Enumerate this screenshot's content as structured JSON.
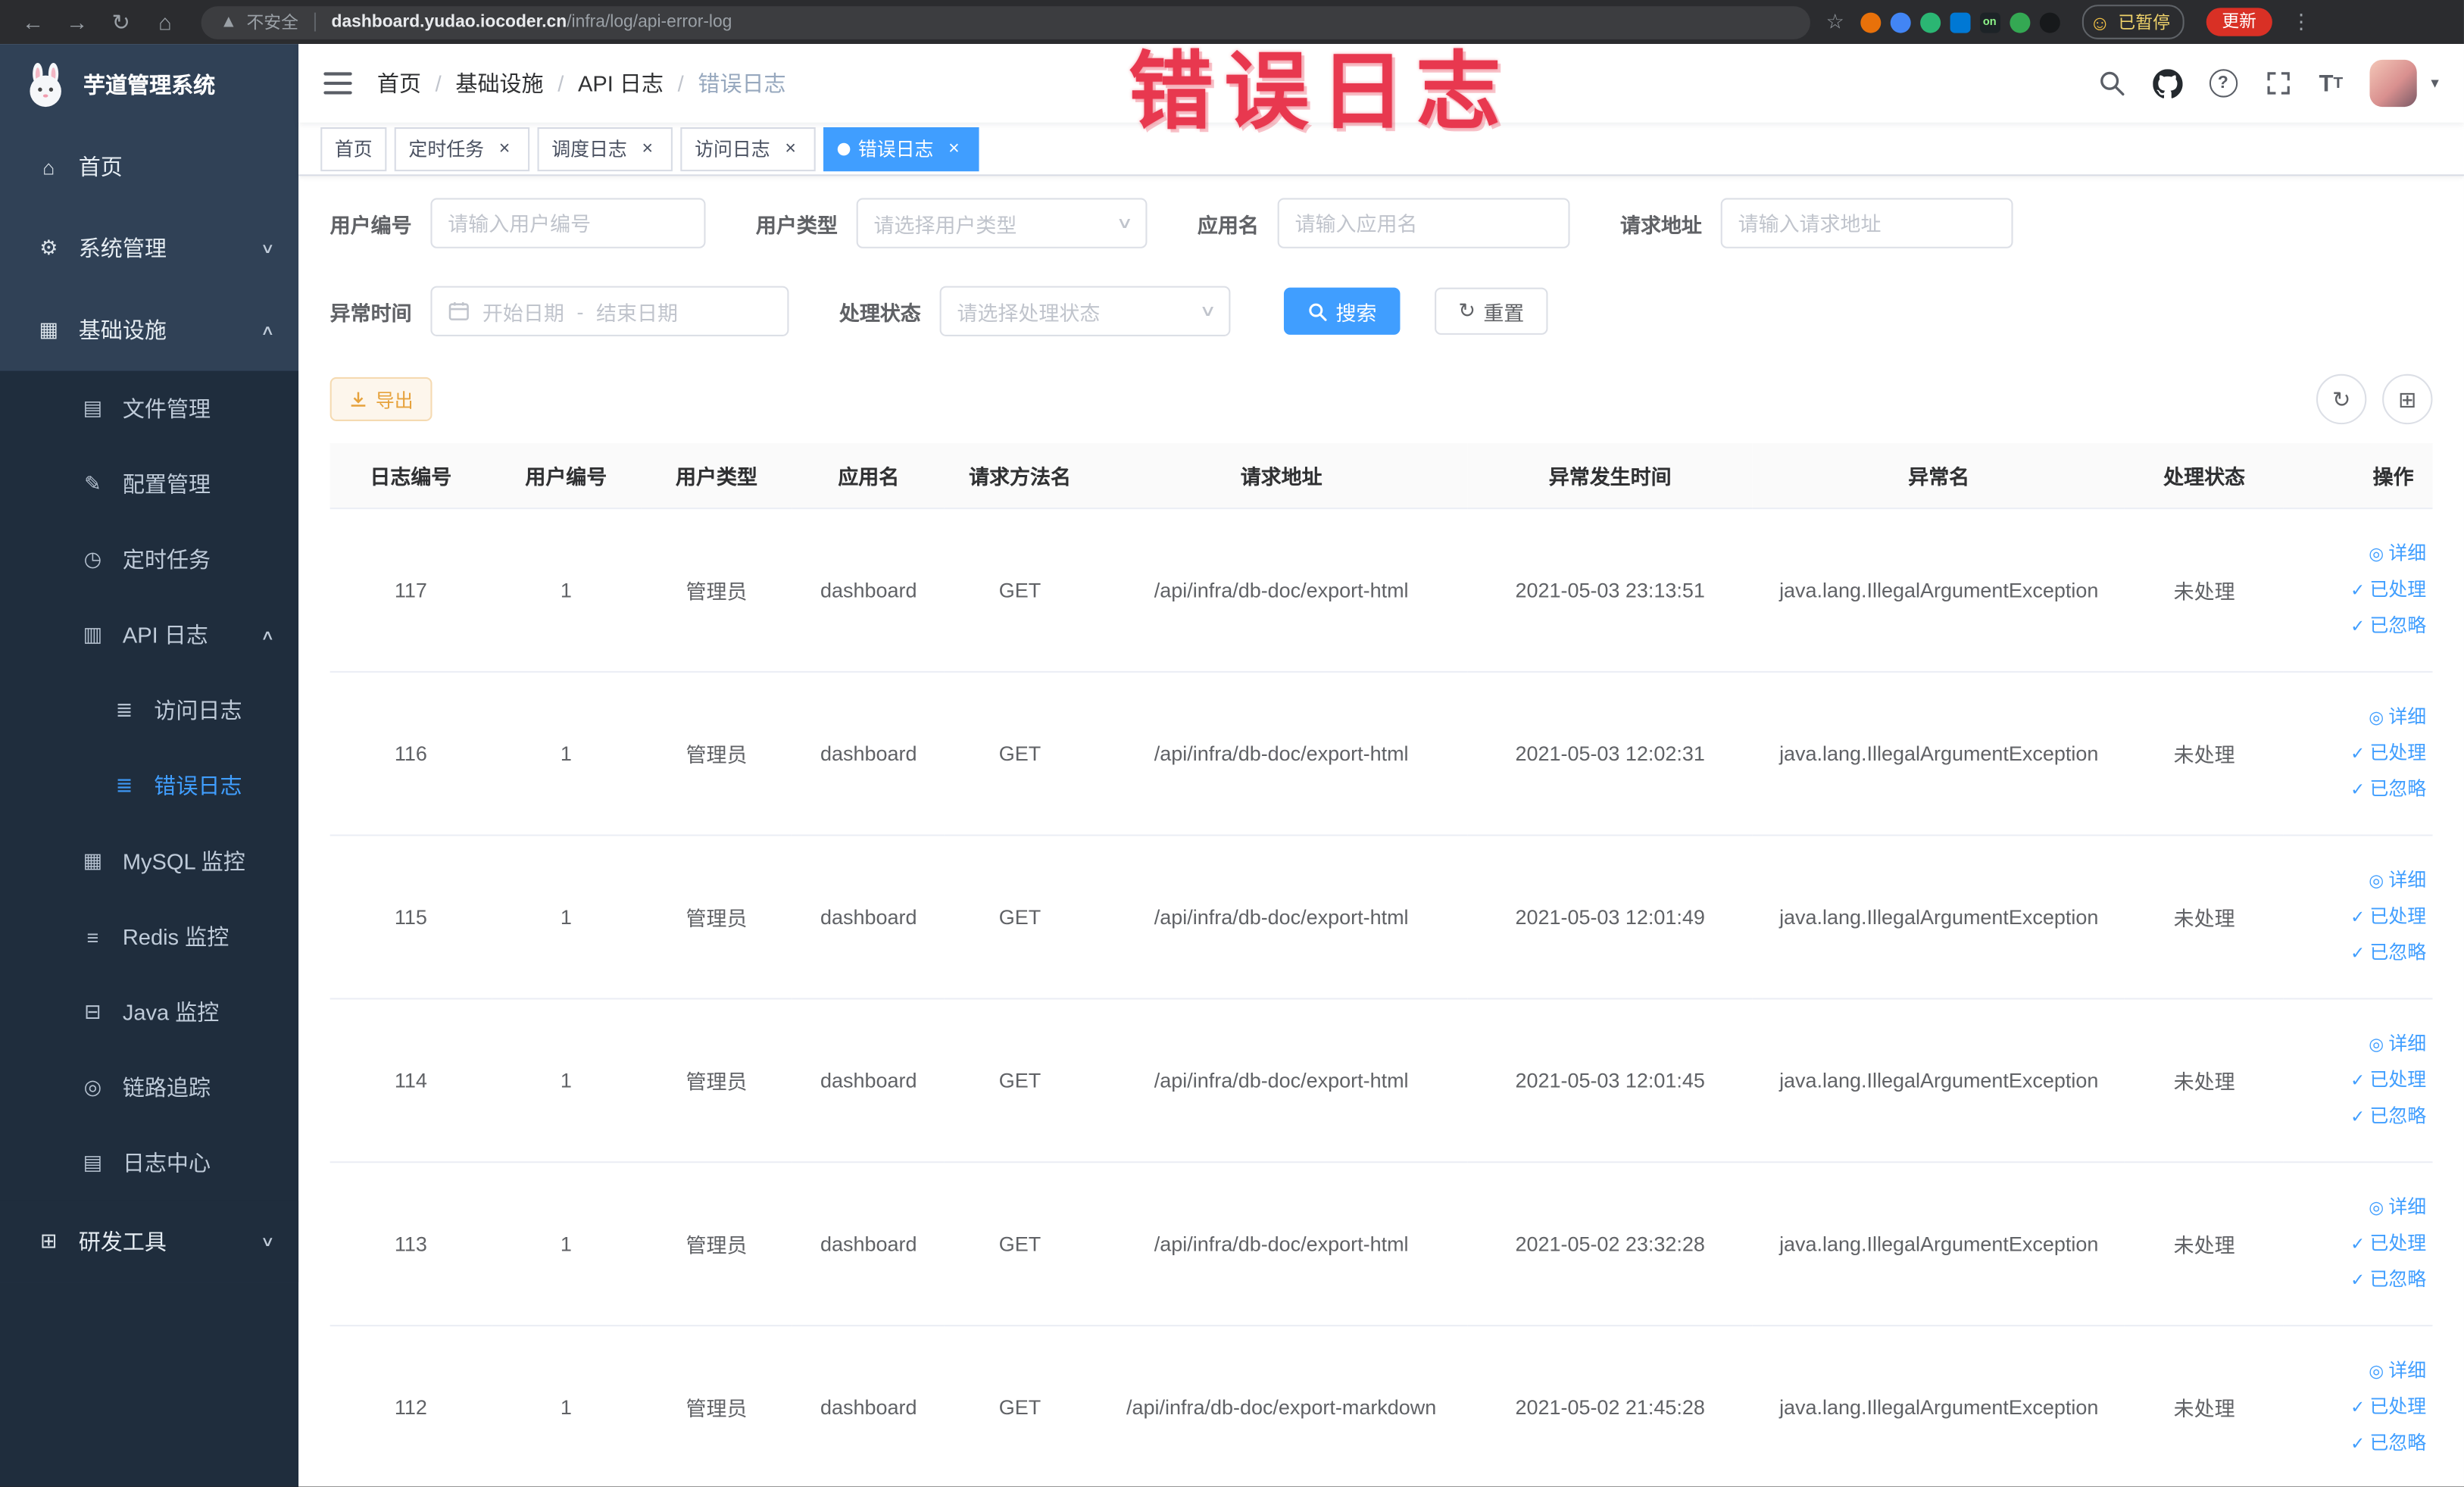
{
  "browser": {
    "security_label": "不安全",
    "url_host": "dashboard.yudao.iocoder.cn",
    "url_path": "/infra/log/api-error-log",
    "extension_on_badge": "on",
    "paused_label": "已暂停",
    "update_label": "更新"
  },
  "annotation": {
    "text": "错误日志"
  },
  "sidebar": {
    "title": "芋道管理系统",
    "items": [
      {
        "label": "首页"
      },
      {
        "label": "系统管理"
      },
      {
        "label": "基础设施"
      },
      {
        "label": "文件管理"
      },
      {
        "label": "配置管理"
      },
      {
        "label": "定时任务"
      },
      {
        "label": "API 日志"
      },
      {
        "label": "访问日志"
      },
      {
        "label": "错误日志"
      },
      {
        "label": "MySQL 监控"
      },
      {
        "label": "Redis 监控"
      },
      {
        "label": "Java 监控"
      },
      {
        "label": "链路追踪"
      },
      {
        "label": "日志中心"
      },
      {
        "label": "研发工具"
      }
    ]
  },
  "header": {
    "breadcrumb": [
      "首页",
      "基础设施",
      "API 日志",
      "错误日志"
    ]
  },
  "tabs": [
    {
      "label": "首页"
    },
    {
      "label": "定时任务"
    },
    {
      "label": "调度日志"
    },
    {
      "label": "访问日志"
    },
    {
      "label": "错误日志"
    }
  ],
  "filters": {
    "user_id_label": "用户编号",
    "user_id_placeholder": "请输入用户编号",
    "user_type_label": "用户类型",
    "user_type_placeholder": "请选择用户类型",
    "app_name_label": "应用名",
    "app_name_placeholder": "请输入应用名",
    "request_url_label": "请求地址",
    "request_url_placeholder": "请输入请求地址",
    "time_label": "异常时间",
    "time_start_placeholder": "开始日期",
    "time_separator": "-",
    "time_end_placeholder": "结束日期",
    "status_label": "处理状态",
    "status_placeholder": "请选择处理状态",
    "search_label": "搜索",
    "reset_label": "重置"
  },
  "toolbar": {
    "export_label": "导出"
  },
  "table": {
    "columns": [
      "日志编号",
      "用户编号",
      "用户类型",
      "应用名",
      "请求方法名",
      "请求地址",
      "异常发生时间",
      "异常名",
      "处理状态",
      "操作"
    ],
    "action_labels": [
      "详细",
      "已处理",
      "已忽略"
    ],
    "rows": [
      {
        "id": "117",
        "user_id": "1",
        "user_type": "管理员",
        "app": "dashboard",
        "method": "GET",
        "url": "/api/infra/db-doc/export-html",
        "time": "2021-05-03 23:13:51",
        "exception": "java.lang.IllegalArgumentException",
        "status": "未处理"
      },
      {
        "id": "116",
        "user_id": "1",
        "user_type": "管理员",
        "app": "dashboard",
        "method": "GET",
        "url": "/api/infra/db-doc/export-html",
        "time": "2021-05-03 12:02:31",
        "exception": "java.lang.IllegalArgumentException",
        "status": "未处理"
      },
      {
        "id": "115",
        "user_id": "1",
        "user_type": "管理员",
        "app": "dashboard",
        "method": "GET",
        "url": "/api/infra/db-doc/export-html",
        "time": "2021-05-03 12:01:49",
        "exception": "java.lang.IllegalArgumentException",
        "status": "未处理"
      },
      {
        "id": "114",
        "user_id": "1",
        "user_type": "管理员",
        "app": "dashboard",
        "method": "GET",
        "url": "/api/infra/db-doc/export-html",
        "time": "2021-05-03 12:01:45",
        "exception": "java.lang.IllegalArgumentException",
        "status": "未处理"
      },
      {
        "id": "113",
        "user_id": "1",
        "user_type": "管理员",
        "app": "dashboard",
        "method": "GET",
        "url": "/api/infra/db-doc/export-html",
        "time": "2021-05-02 23:32:28",
        "exception": "java.lang.IllegalArgumentException",
        "status": "未处理"
      },
      {
        "id": "112",
        "user_id": "1",
        "user_type": "管理员",
        "app": "dashboard",
        "method": "GET",
        "url": "/api/infra/db-doc/export-markdown",
        "time": "2021-05-02 21:45:28",
        "exception": "java.lang.IllegalArgumentException",
        "status": "未处理"
      }
    ]
  },
  "colors": {
    "primary": "#409eff",
    "sidebar_bg": "#304156",
    "submenu_bg": "#1f2d3d",
    "warning": "#e6a23c",
    "annotation": "#e8384f"
  }
}
